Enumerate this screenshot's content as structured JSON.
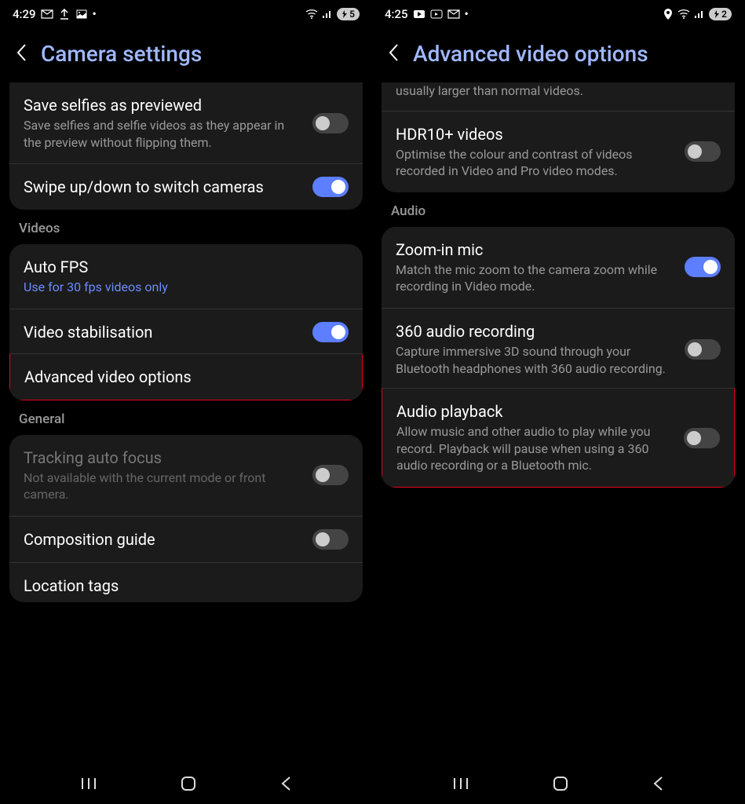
{
  "left": {
    "status": {
      "time": "4:29",
      "battery": "5"
    },
    "header_title": "Camera settings",
    "top_card": [
      {
        "title": "Save selfies as previewed",
        "sub": "Save selfies and selfie videos as they appear in the preview without flipping them.",
        "toggle": "off"
      },
      {
        "title": "Swipe up/down to switch cameras",
        "toggle": "on"
      }
    ],
    "section_videos": "Videos",
    "videos_card": [
      {
        "title": "Auto FPS",
        "sub": "Use for 30 fps videos only",
        "sub_blue": true
      },
      {
        "title": "Video stabilisation",
        "toggle": "on"
      },
      {
        "title": "Advanced video options",
        "highlight": true
      }
    ],
    "section_general": "General",
    "general_card": [
      {
        "title": "Tracking auto focus",
        "sub": "Not available with the current mode or front camera.",
        "toggle": "off",
        "disabled": true
      },
      {
        "title": "Composition guide",
        "toggle": "off"
      },
      {
        "title": "Location tags"
      }
    ]
  },
  "right": {
    "status": {
      "time": "4:25",
      "battery": "2"
    },
    "header_title": "Advanced video options",
    "partial_sub": "usually larger than normal videos.",
    "top_card": [
      {
        "title": "HDR10+ videos",
        "sub": "Optimise the colour and contrast of videos recorded in Video and Pro video modes.",
        "toggle": "off"
      }
    ],
    "section_audio": "Audio",
    "audio_card": [
      {
        "title": "Zoom-in mic",
        "sub": "Match the mic zoom to the camera zoom while recording in Video mode.",
        "toggle": "on"
      },
      {
        "title": "360 audio recording",
        "sub": "Capture immersive 3D sound through your Bluetooth headphones with 360 audio recording.",
        "toggle": "off"
      },
      {
        "title": "Audio playback",
        "sub": "Allow music and other audio to play while you record. Playback will pause when using a 360 audio recording or a Bluetooth mic.",
        "toggle": "off",
        "highlight": true
      }
    ]
  }
}
